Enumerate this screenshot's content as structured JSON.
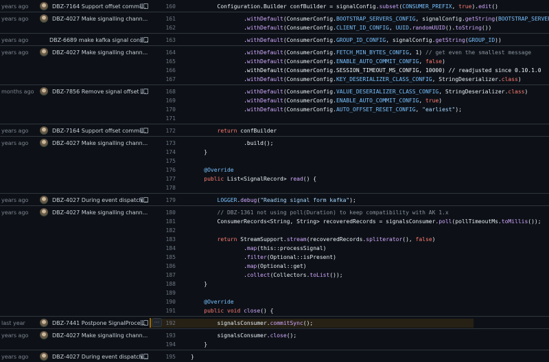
{
  "colors": {
    "background": "#0d1117",
    "keyword": "#ff7b72",
    "function": "#d2a8ff",
    "constant": "#79c0ff",
    "string": "#a5d6ff",
    "comment": "#8b949e",
    "highlight_bar": "#9e6a03"
  },
  "more_button_label": "···",
  "groups": [
    {
      "age": "years ago",
      "message": "DBZ-7164 Support offset commi...",
      "avatar": true,
      "reblame": true,
      "lines": [
        {
          "n": "160",
          "code": "        Configuration.Builder confBuilder = signalConfig.subset(CONSUMER_PREFIX, true).edit()"
        }
      ]
    },
    {
      "age": "years ago",
      "message": "DBZ-4027 Make signalling chann...",
      "avatar": true,
      "reblame": false,
      "lines": [
        {
          "n": "161",
          "code": "                .withDefault(ConsumerConfig.BOOTSTRAP_SERVERS_CONFIG, signalConfig.getString(BOOTSTRAP_SERVERS))"
        },
        {
          "n": "162",
          "code": "                .withDefault(ConsumerConfig.CLIENT_ID_CONFIG, UUID.randomUUID().toString())"
        }
      ]
    },
    {
      "age": "years ago",
      "message": "DBZ-6689 make kafka signal cons...",
      "avatar": false,
      "reblame": true,
      "lines": [
        {
          "n": "163",
          "code": "                .withDefault(ConsumerConfig.GROUP_ID_CONFIG, signalConfig.getString(GROUP_ID))"
        }
      ]
    },
    {
      "age": "years ago",
      "message": "DBZ-4027 Make signalling chann...",
      "avatar": true,
      "reblame": false,
      "lines": [
        {
          "n": "164",
          "code": "                .withDefault(ConsumerConfig.FETCH_MIN_BYTES_CONFIG, 1) // get even the smallest message"
        },
        {
          "n": "165",
          "code": "                .withDefault(ConsumerConfig.ENABLE_AUTO_COMMIT_CONFIG, false)"
        },
        {
          "n": "166",
          "code": "                .withDefault(ConsumerConfig.SESSION_TIMEOUT_MS_CONFIG, 10000) // readjusted since 0.10.1.0"
        },
        {
          "n": "167",
          "code": "                .withDefault(ConsumerConfig.KEY_DESERIALIZER_CLASS_CONFIG, StringDeserializer.class)"
        }
      ]
    },
    {
      "age": "months ago",
      "message": "DBZ-7856 Remove signal offset ...",
      "avatar": true,
      "reblame": true,
      "lines": [
        {
          "n": "168",
          "code": "                .withDefault(ConsumerConfig.VALUE_DESERIALIZER_CLASS_CONFIG, StringDeserializer.class)"
        },
        {
          "n": "169",
          "code": "                .withDefault(ConsumerConfig.ENABLE_AUTO_COMMIT_CONFIG, true)"
        },
        {
          "n": "170",
          "code": "                .withDefault(ConsumerConfig.AUTO_OFFSET_RESET_CONFIG, \"earliest\");"
        },
        {
          "n": "171",
          "code": ""
        }
      ]
    },
    {
      "age": "years ago",
      "message": "DBZ-7164 Support offset commi...",
      "avatar": true,
      "reblame": true,
      "lines": [
        {
          "n": "172",
          "code": "        return confBuilder"
        }
      ]
    },
    {
      "age": "years ago",
      "message": "DBZ-4027 Make signalling chann...",
      "avatar": true,
      "reblame": false,
      "lines": [
        {
          "n": "173",
          "code": "                .build();"
        },
        {
          "n": "174",
          "code": "    }"
        },
        {
          "n": "175",
          "code": ""
        },
        {
          "n": "176",
          "code": "    @Override"
        },
        {
          "n": "177",
          "code": "    public List<SignalRecord> read() {"
        },
        {
          "n": "178",
          "code": ""
        }
      ]
    },
    {
      "age": "years ago",
      "message": "DBZ-4027 During event dispatch...",
      "avatar": true,
      "reblame": true,
      "lines": [
        {
          "n": "179",
          "code": "        LOGGER.debug(\"Reading signal form kafka\");"
        }
      ]
    },
    {
      "age": "years ago",
      "message": "DBZ-4027 Make signalling chann...",
      "avatar": true,
      "reblame": false,
      "lines": [
        {
          "n": "180",
          "code": "        // DBZ-1361 not using poll(Duration) to keep compatibility with AK 1.x"
        },
        {
          "n": "181",
          "code": "        ConsumerRecords<String, String> recoveredRecords = signalsConsumer.poll(pollTimeoutMs.toMillis());"
        },
        {
          "n": "182",
          "code": ""
        },
        {
          "n": "183",
          "code": "        return StreamSupport.stream(recoveredRecords.spliterator(), false)"
        },
        {
          "n": "184",
          "code": "                .map(this::processSignal)"
        },
        {
          "n": "185",
          "code": "                .filter(Optional::isPresent)"
        },
        {
          "n": "186",
          "code": "                .map(Optional::get)"
        },
        {
          "n": "187",
          "code": "                .collect(Collectors.toList());"
        },
        {
          "n": "188",
          "code": "    }"
        },
        {
          "n": "189",
          "code": ""
        },
        {
          "n": "190",
          "code": "    @Override"
        },
        {
          "n": "191",
          "code": "    public void close() {"
        }
      ]
    },
    {
      "age": "last year",
      "message": "DBZ-7441 Postpone SignalProce...",
      "avatar": true,
      "reblame": true,
      "highlight": true,
      "lines": [
        {
          "n": "192",
          "code": "        signalsConsumer.commitSync();"
        }
      ]
    },
    {
      "age": "years ago",
      "message": "DBZ-4027 Make signalling chann...",
      "avatar": true,
      "reblame": false,
      "lines": [
        {
          "n": "193",
          "code": "        signalsConsumer.close();"
        },
        {
          "n": "194",
          "code": "    }"
        }
      ]
    },
    {
      "age": "years ago",
      "message": "DBZ-4027 During event dispatch...",
      "avatar": true,
      "reblame": true,
      "lines": [
        {
          "n": "195",
          "code": "}"
        }
      ]
    }
  ]
}
